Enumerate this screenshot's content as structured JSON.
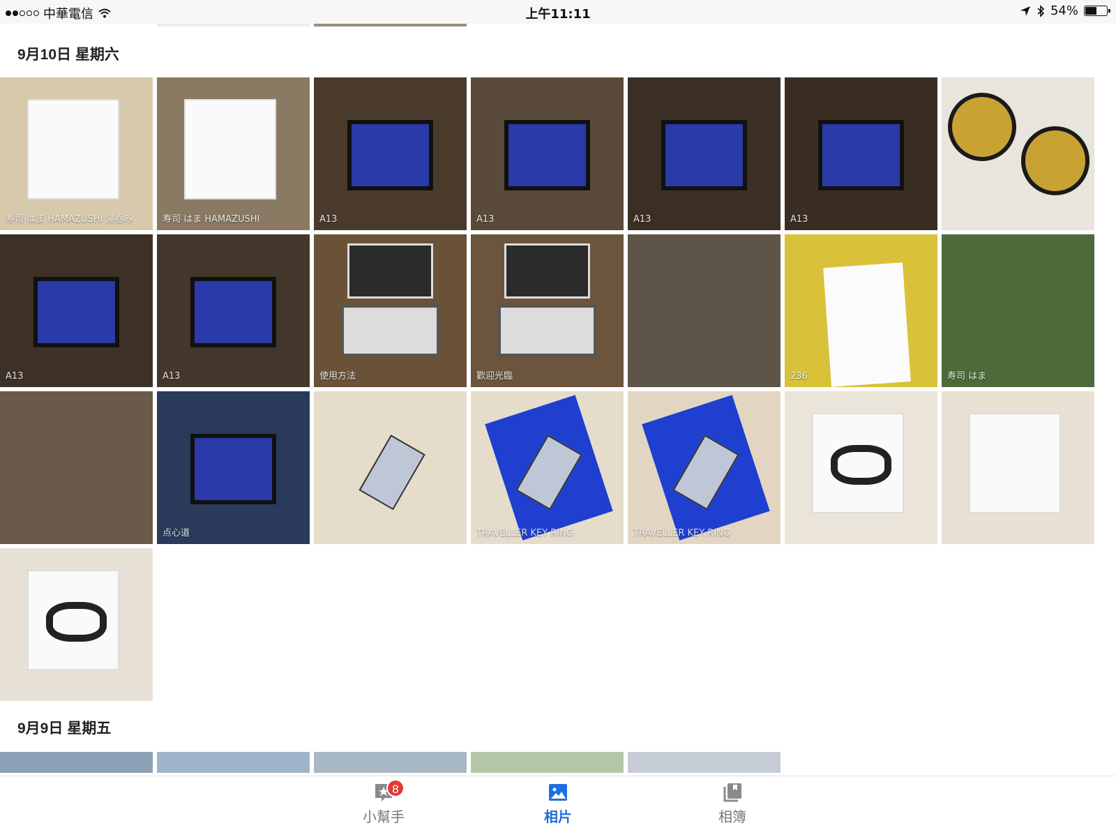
{
  "status_bar": {
    "signal_dots": 2,
    "carrier": "中華電信",
    "time": "上午11:11",
    "battery_text": "54%",
    "battery_level": 0.54
  },
  "sections": [
    {
      "date": "9月10日 星期六",
      "photos": [
        {
          "name": "photo-hamazushi-cup-and-box",
          "bg": "#d8c9ad",
          "motif": "box",
          "caption": "寿司 はま HAMAZUSHI 湯呑み"
        },
        {
          "name": "photo-hamazushi-box",
          "bg": "#8a7a63",
          "motif": "box",
          "caption": "寿司 はま HAMAZUSHI"
        },
        {
          "name": "photo-order-screen-a13",
          "bg": "#4a3a2c",
          "motif": "screen",
          "caption": "A13"
        },
        {
          "name": "photo-order-screen-menu",
          "bg": "#5a4a3a",
          "motif": "screen",
          "caption": "A13"
        },
        {
          "name": "photo-order-screen-dish",
          "bg": "#3b2f25",
          "motif": "screen",
          "caption": "A13"
        },
        {
          "name": "photo-order-screen-dish-2",
          "bg": "#3a2e24",
          "motif": "screen",
          "caption": "A13"
        },
        {
          "name": "photo-sushi-plates",
          "bg": "#e9e4dc",
          "motif": "plate",
          "caption": ""
        },
        {
          "name": "photo-order-screen-a13-2",
          "bg": "#3d3127",
          "motif": "screen",
          "caption": "A13"
        },
        {
          "name": "photo-order-screen-a13-3",
          "bg": "#43362a",
          "motif": "screen",
          "caption": "A13"
        },
        {
          "name": "photo-kiosk-instructions",
          "bg": "#6a5238",
          "motif": "kiosk",
          "caption": "使用方法"
        },
        {
          "name": "photo-kiosk-welcome",
          "bg": "#6b553d",
          "motif": "kiosk",
          "caption": "歡迎光臨"
        },
        {
          "name": "photo-restaurant-interior",
          "bg": "#5e5448",
          "motif": "none",
          "caption": ""
        },
        {
          "name": "photo-receipt",
          "bg": "#d9c23a",
          "motif": "receipt",
          "caption": "236"
        },
        {
          "name": "photo-counter-staff",
          "bg": "#4d6b3a",
          "motif": "none",
          "caption": "寿司 はま"
        },
        {
          "name": "photo-dining-area",
          "bg": "#6a5a4a",
          "motif": "none",
          "caption": ""
        },
        {
          "name": "photo-tablet-screen",
          "bg": "#2a3a5a",
          "motif": "screen",
          "caption": "点心道"
        },
        {
          "name": "photo-keyring-silver",
          "bg": "#e6dccb",
          "motif": "tag",
          "caption": ""
        },
        {
          "name": "photo-keyring-card",
          "bg": "#e6dccb",
          "motif": "card",
          "caption": "TRAVELLER KEY RING"
        },
        {
          "name": "photo-keyring-card-2",
          "bg": "#e2d6c2",
          "motif": "card",
          "caption": "TRAVELLER KEY RING"
        },
        {
          "name": "photo-mi-band-box",
          "bg": "#ebe4d8",
          "motif": "band",
          "caption": ""
        },
        {
          "name": "photo-mi-band-box-back",
          "bg": "#e9e1d3",
          "motif": "box",
          "caption": ""
        },
        {
          "name": "photo-mi-band-box-2",
          "bg": "#e8e1d5",
          "motif": "band",
          "caption": ""
        }
      ]
    },
    {
      "date": "9月9日 星期五",
      "photos": [
        {
          "name": "photo-sep9-1",
          "bg": "#8aa0b5",
          "motif": "none",
          "caption": ""
        },
        {
          "name": "photo-sep9-2",
          "bg": "#9fb4c9",
          "motif": "none",
          "caption": ""
        },
        {
          "name": "photo-sep9-3",
          "bg": "#a8b8c4",
          "motif": "none",
          "caption": ""
        },
        {
          "name": "photo-sep9-4",
          "bg": "#b4c7a8",
          "motif": "none",
          "caption": ""
        },
        {
          "name": "photo-sep9-5",
          "bg": "#c5ccd6",
          "motif": "none",
          "caption": ""
        }
      ]
    }
  ],
  "tab_bar": {
    "tabs": [
      {
        "name": "tab-assistant",
        "label": "小幫手",
        "icon": "assistant-icon",
        "badge": "8",
        "active": false
      },
      {
        "name": "tab-photos",
        "label": "相片",
        "icon": "photos-icon",
        "badge": "",
        "active": true
      },
      {
        "name": "tab-albums",
        "label": "相簿",
        "icon": "albums-icon",
        "badge": "",
        "active": false
      }
    ]
  },
  "colors": {
    "accent": "#1e6fe0",
    "badge": "#e53935",
    "inactive": "#777777"
  }
}
